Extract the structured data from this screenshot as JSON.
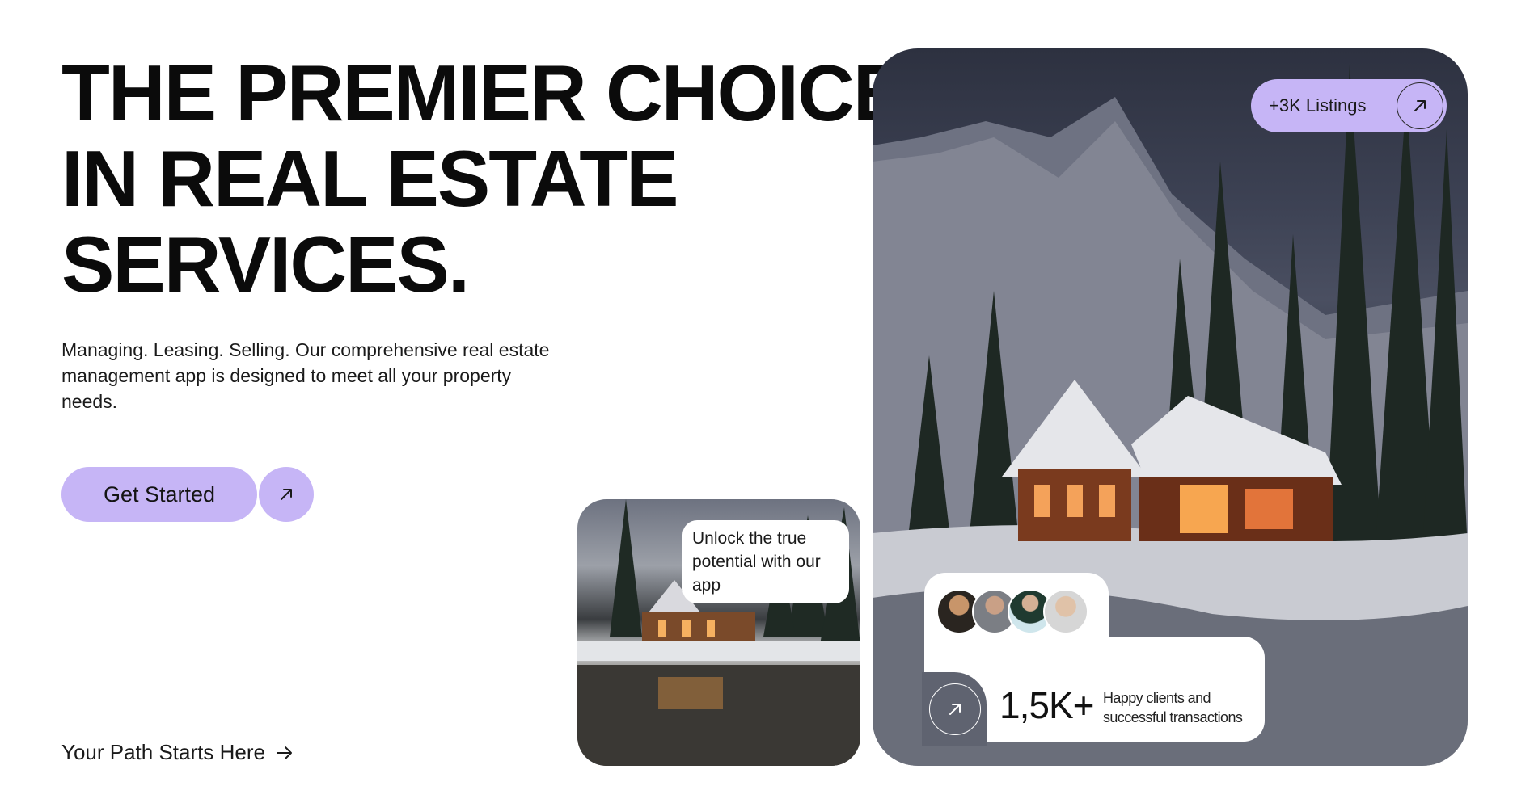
{
  "hero": {
    "headline_lines": [
      "THE PREMIER CHOICE",
      "IN REAL ESTATE",
      "SERVICES."
    ],
    "description": "Managing. Leasing. Selling. Our comprehensive real estate management app is designed to meet all your property needs.",
    "cta_label": "Get Started",
    "path_link": "Your Path Starts Here"
  },
  "listings": {
    "label": "+3K Listings"
  },
  "promo": {
    "bubble_text": "Unlock the true potential with our app"
  },
  "stats": {
    "value": "1,5K+",
    "caption": "Happy clients and successful transactions"
  },
  "colors": {
    "accent": "#c6b5f6",
    "text": "#0b0b0b"
  },
  "icons": {
    "cta": "arrow-up-right-icon",
    "path": "arrow-right-icon",
    "listings": "arrow-up-right-icon",
    "stats": "arrow-up-right-icon"
  }
}
